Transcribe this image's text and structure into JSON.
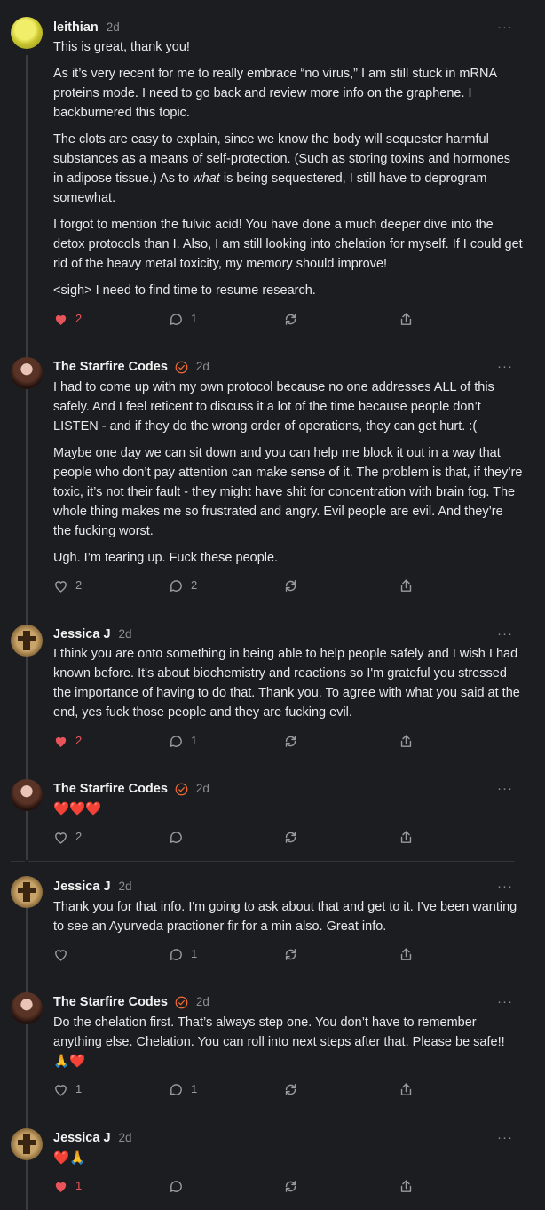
{
  "comments": [
    {
      "author": "leithian",
      "time": "2d",
      "paragraphs": [
        "This is great, thank you!",
        "As it’s very recent for me to really embrace “no virus,” I am still stuck in mRNA proteins mode. I need to go back and review more info on the graphene. I backburnered this topic.",
        "The clots are easy to explain, since we know the body will sequester harmful substances as a means of self-protection. (Such as storing toxins and hormones in adipose tissue.) As to ",
        "I forgot to mention the fulvic acid! You have done a much deeper dive into the detox protocols than I. Also, I am still looking into chelation for myself. If I could get rid of the heavy metal toxicity, my memory should improve!",
        "<sigh> I need to find time to resume research."
      ],
      "p3_em": "what",
      "p3_rest": " is being sequestered, I still have to deprogram somewhat.",
      "likes": "2",
      "replies": "1"
    },
    {
      "author": "The Starfire Codes",
      "time": "2d",
      "paragraphs": [
        "I had to come up with my own protocol because no one addresses ALL of this safely. And I feel reticent to discuss it a lot of the time because people don’t LISTEN - and if they do the wrong order of operations, they can get hurt. :(",
        "Maybe one day we can sit down and you can help me block it out in a way that people who don’t pay attention can make sense of it. The problem is that, if they’re toxic, it’s not their fault - they might have shit for concentration with brain fog. The whole thing makes me so frustrated and angry. Evil people are evil. And they’re the fucking worst.",
        "Ugh. I’m tearing up. Fuck these people."
      ],
      "likes": "2",
      "replies": "2"
    },
    {
      "author": "Jessica J",
      "time": "2d",
      "paragraphs": [
        "I think you are onto something in being able to help people safely and I wish I had known before. It's about biochemistry and reactions so I'm grateful you stressed the importance of having to do that. Thank you. To agree with what you said at the end, yes fuck those people and they are fucking evil."
      ],
      "likes": "2",
      "replies": "1"
    },
    {
      "author": "The Starfire Codes",
      "time": "2d",
      "paragraphs": [
        "❤️❤️❤️"
      ],
      "likes": "2",
      "replies": ""
    },
    {
      "author": "Jessica J",
      "time": "2d",
      "paragraphs": [
        "Thank you for that info. I'm going to ask about that and get to it. I've been wanting to see an Ayurveda practioner fir for a min also. Great info."
      ],
      "likes": "",
      "replies": "1"
    },
    {
      "author": "The Starfire Codes",
      "time": "2d",
      "paragraphs": [
        "Do the chelation first. That’s always step one. You don’t have to remember anything else. Chelation. You can roll into next steps after that. Please be safe!! 🙏❤️"
      ],
      "likes": "1",
      "replies": "1"
    },
    {
      "author": "Jessica J",
      "time": "2d",
      "paragraphs": [
        "❤️🙏"
      ],
      "likes": "1",
      "replies": ""
    }
  ],
  "icons": {
    "more": "more-icon",
    "like": "heart-icon",
    "reply": "comment-icon",
    "restack": "restack-icon",
    "share": "share-icon",
    "badge": "verified-badge-icon"
  },
  "colors": {
    "background": "#1c1d20",
    "liked": "#e8545a",
    "badge": "#f06a35",
    "muted": "#8b8c90"
  }
}
